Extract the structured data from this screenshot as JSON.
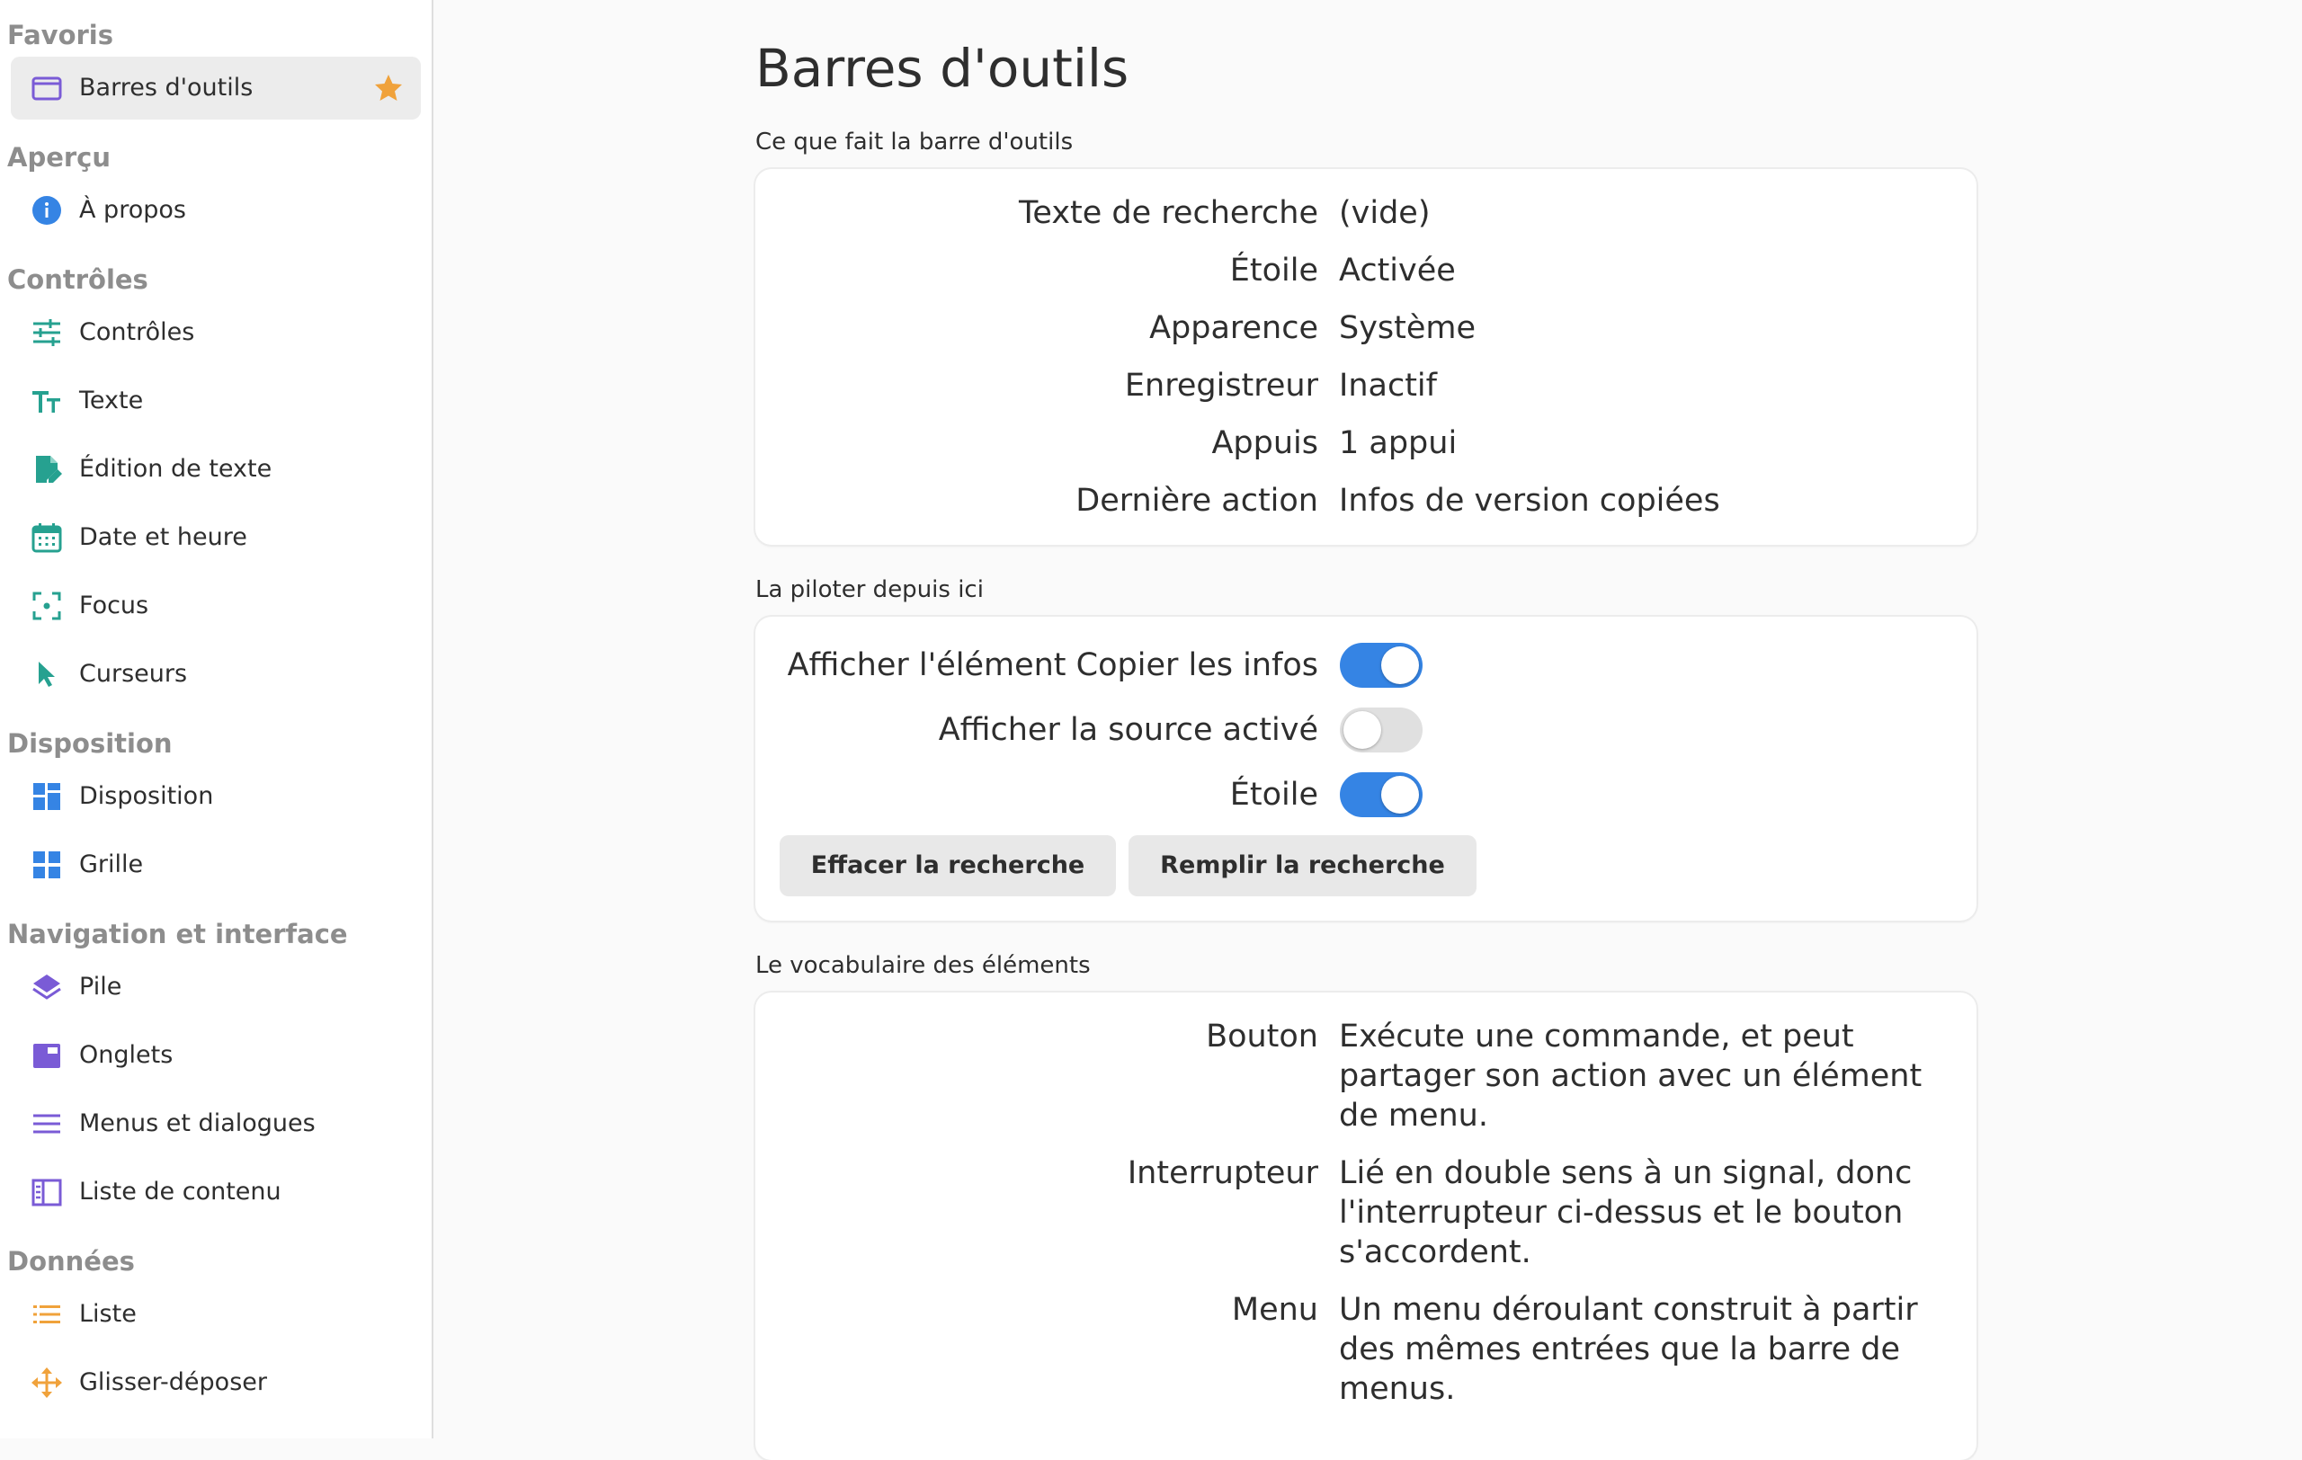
{
  "sidebar": {
    "sections": [
      {
        "title": "Favoris",
        "items": [
          {
            "label": "Barres d'outils",
            "icon": "window-icon",
            "selected": true,
            "favorite": true
          }
        ]
      },
      {
        "title": "Aperçu",
        "items": [
          {
            "label": "À propos",
            "icon": "info-icon"
          }
        ]
      },
      {
        "title": "Contrôles",
        "items": [
          {
            "label": "Contrôles",
            "icon": "sliders-icon"
          },
          {
            "label": "Texte",
            "icon": "text-size-icon"
          },
          {
            "label": "Édition de texte",
            "icon": "document-edit-icon"
          },
          {
            "label": "Date et heure",
            "icon": "calendar-icon"
          },
          {
            "label": "Focus",
            "icon": "focus-icon"
          },
          {
            "label": "Curseurs",
            "icon": "pointer-icon"
          }
        ]
      },
      {
        "title": "Disposition",
        "items": [
          {
            "label": "Disposition",
            "icon": "layout-icon"
          },
          {
            "label": "Grille",
            "icon": "grid-icon"
          }
        ]
      },
      {
        "title": "Navigation et interface",
        "items": [
          {
            "label": "Pile",
            "icon": "stack-icon"
          },
          {
            "label": "Onglets",
            "icon": "tabs-icon"
          },
          {
            "label": "Menus et dialogues",
            "icon": "menu-lines-icon"
          },
          {
            "label": "Liste de contenu",
            "icon": "sidebar-list-icon"
          }
        ]
      },
      {
        "title": "Données",
        "items": [
          {
            "label": "Liste",
            "icon": "list-icon"
          },
          {
            "label": "Glisser-déposer",
            "icon": "move-arrows-icon"
          }
        ]
      }
    ]
  },
  "main": {
    "title": "Barres d'outils",
    "info_group": {
      "title": "Ce que fait la barre d'outils",
      "rows": [
        {
          "key": "Texte de recherche",
          "value": "(vide)"
        },
        {
          "key": "Étoile",
          "value": "Activée"
        },
        {
          "key": "Apparence",
          "value": "Système"
        },
        {
          "key": "Enregistreur",
          "value": "Inactif"
        },
        {
          "key": "Appuis",
          "value": "1 appui"
        },
        {
          "key": "Dernière action",
          "value": "Infos de version copiées"
        }
      ]
    },
    "control_group": {
      "title": "La piloter depuis ici",
      "toggles": [
        {
          "label": "Afficher l'élément Copier les infos",
          "on": true
        },
        {
          "label": "Afficher la source activé",
          "on": false
        },
        {
          "label": "Étoile",
          "on": true
        }
      ],
      "buttons": {
        "clear": "Effacer la recherche",
        "fill": "Remplir la recherche"
      }
    },
    "vocab_group": {
      "title": "Le vocabulaire des éléments",
      "rows": [
        {
          "key": "Bouton",
          "lines": [
            "Exécute une commande, et peut",
            "partager son action avec un élément",
            "de menu."
          ]
        },
        {
          "key": "Interrupteur",
          "lines": [
            "Lié en double sens à un signal, donc",
            "l'interrupteur ci-dessus et le bouton",
            "s'accordent."
          ]
        },
        {
          "key": "Menu",
          "lines": [
            "Un menu déroulant construit à partir",
            "des mêmes entrées que la barre de",
            "menus."
          ]
        }
      ]
    }
  },
  "colors": {
    "accent": "#3584e4",
    "star": "#f0a23b",
    "teal": "#26a190",
    "purple": "#7a5bd6",
    "orange": "#f0a23b",
    "blue": "#3584e4"
  }
}
